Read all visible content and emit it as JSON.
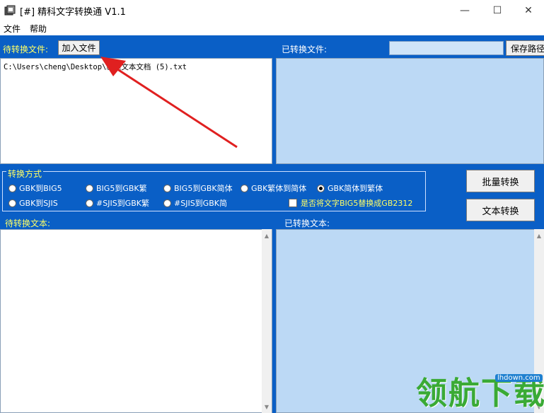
{
  "window": {
    "title": "[#] 精科文字转换通 V1.1",
    "controls": {
      "minimize": "—",
      "maximize": "☐",
      "close": "✕"
    }
  },
  "menu": {
    "file": "文件",
    "help": "帮助"
  },
  "files": {
    "pending_label": "待转换文件:",
    "add_button": "加入文件",
    "pending_path": "C:\\Users\\cheng\\Desktop\\新建文本文档 (5).txt",
    "converted_label": "已转换文件:",
    "save_path_value": "",
    "save_path_button": "保存路径"
  },
  "mode": {
    "legend": "转换方式",
    "options": [
      {
        "label": "GBK到BIG5",
        "selected": false
      },
      {
        "label": "BIG5到GBK繁",
        "selected": false
      },
      {
        "label": "BIG5到GBK简体",
        "selected": false
      },
      {
        "label": "GBK繁体到简体",
        "selected": false
      },
      {
        "label": "GBK简体到繁体",
        "selected": true
      },
      {
        "label": "GBK到SJIS",
        "selected": false
      },
      {
        "label": "#SJIS到GBK繁",
        "selected": false
      },
      {
        "label": "#SJIS到GBK简",
        "selected": false
      }
    ],
    "big5_checkbox": "是否将文字BIG5替换成GB2312"
  },
  "actions": {
    "batch": "批量转换",
    "text": "文本转换"
  },
  "text": {
    "pending_label": "待转换文本:",
    "converted_label": "已转换文本:",
    "pending_value": "",
    "converted_value": ""
  },
  "watermark": {
    "text": "领航下载",
    "url": "lhdown.com"
  },
  "colors": {
    "background": "#0a5fc6",
    "label_yellow": "#ffff66",
    "panel_blue": "#bcd9f5",
    "annotation_red": "#e02020"
  }
}
